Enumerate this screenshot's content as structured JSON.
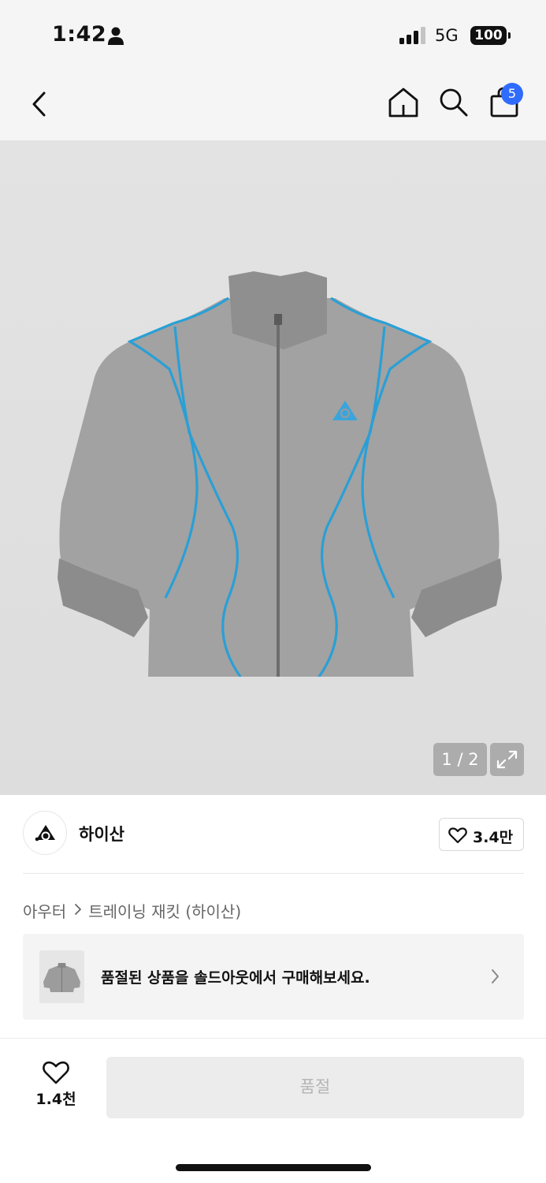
{
  "status_bar": {
    "time": "1:42",
    "network": "5G",
    "battery": "100"
  },
  "nav": {
    "back_icon": "chevron-left-icon",
    "home_icon": "home-icon",
    "search_icon": "search-icon",
    "cart_icon": "shopping-bag-icon",
    "cart_count": "5",
    "badge_color": "#2f6bff"
  },
  "gallery": {
    "page_indicator": "1 / 2",
    "expand_icon": "expand-icon"
  },
  "brand": {
    "name": "하이산",
    "like_count": "3.4만"
  },
  "breadcrumb": {
    "category": "아우터",
    "separator_icon": "chevron-right-icon",
    "product_name": "트레이닝 재킷 (하이산)"
  },
  "soldout_banner": {
    "text": "품절된 상품을 솔드아웃에서 구매해보세요."
  },
  "bottom_bar": {
    "like_count": "1.4천",
    "action_label": "품절"
  }
}
